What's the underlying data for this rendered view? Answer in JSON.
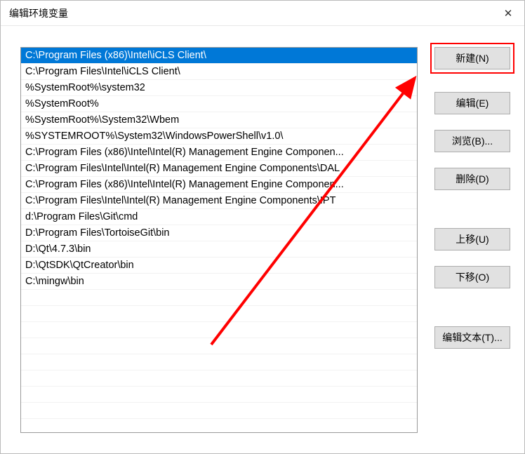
{
  "title": "编辑环境变量",
  "list": {
    "items": [
      "C:\\Program Files (x86)\\Intel\\iCLS Client\\",
      "C:\\Program Files\\Intel\\iCLS Client\\",
      "%SystemRoot%\\system32",
      "%SystemRoot%",
      "%SystemRoot%\\System32\\Wbem",
      "%SYSTEMROOT%\\System32\\WindowsPowerShell\\v1.0\\",
      "C:\\Program Files (x86)\\Intel\\Intel(R) Management Engine Componen...",
      "C:\\Program Files\\Intel\\Intel(R) Management Engine Components\\DAL",
      "C:\\Program Files (x86)\\Intel\\Intel(R) Management Engine Componen...",
      "C:\\Program Files\\Intel\\Intel(R) Management Engine Components\\IPT",
      "d:\\Program Files\\Git\\cmd",
      "D:\\Program Files\\TortoiseGit\\bin",
      "D:\\Qt\\4.7.3\\bin",
      "D:\\QtSDK\\QtCreator\\bin",
      "C:\\mingw\\bin"
    ],
    "selectedIndex": 0
  },
  "buttons": {
    "new": "新建(N)",
    "edit": "编辑(E)",
    "browse": "浏览(B)...",
    "delete": "删除(D)",
    "moveUp": "上移(U)",
    "moveDown": "下移(O)",
    "editText": "编辑文本(T)..."
  },
  "annotation": {
    "highlightButton": "new",
    "arrowColor": "#ff0000"
  }
}
